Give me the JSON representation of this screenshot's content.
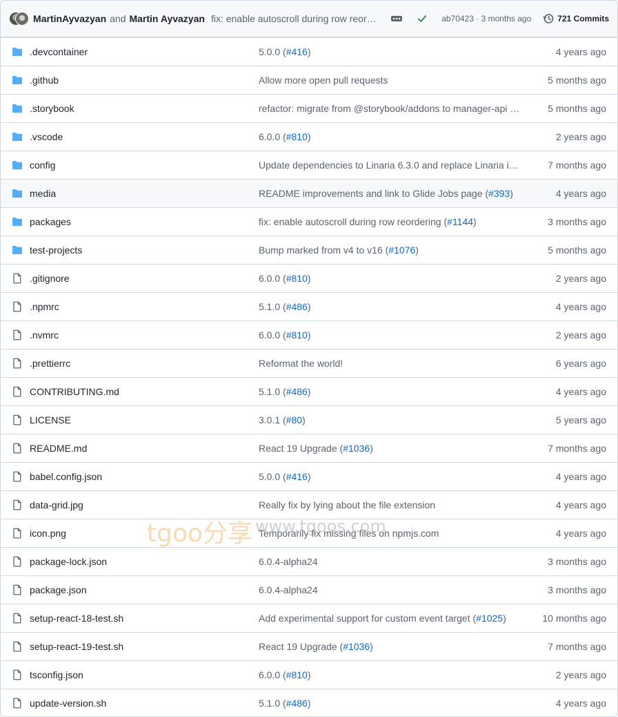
{
  "header": {
    "author1": "MartinAyvazyan",
    "and_text": "and",
    "author2": "Martin Ayvazyan",
    "commit_message": "fix: enable autoscroll during row reorde…",
    "sha_time": "ab70423 · 3 months ago",
    "commits_count": "721 Commits"
  },
  "files": [
    {
      "type": "folder",
      "name": ".devcontainer",
      "msg": "5.0.0 (",
      "link": "#416",
      "msg_end": ")",
      "age": "4 years ago"
    },
    {
      "type": "folder",
      "name": ".github",
      "msg": "Allow more open pull requests",
      "link": "",
      "msg_end": "",
      "age": "5 months ago"
    },
    {
      "type": "folder",
      "name": ".storybook",
      "msg": "refactor: migrate from @storybook/addons to manager-api …",
      "link": "",
      "msg_end": "",
      "age": "5 months ago"
    },
    {
      "type": "folder",
      "name": ".vscode",
      "msg": "6.0.0 (",
      "link": "#810",
      "msg_end": ")",
      "age": "2 years ago"
    },
    {
      "type": "folder",
      "name": "config",
      "msg": "Update dependencies to Linaria 6.3.0 and replace Linaria im…",
      "link": "",
      "msg_end": "",
      "age": "7 months ago"
    },
    {
      "type": "folder",
      "name": "media",
      "msg": "README improvements and link to Glide Jobs page (",
      "link": "#393",
      "msg_end": ")",
      "age": "4 years ago",
      "highlight": true
    },
    {
      "type": "folder",
      "name": "packages",
      "msg": "fix: enable autoscroll during row reordering (",
      "link": "#1144",
      "msg_end": ")",
      "age": "3 months ago"
    },
    {
      "type": "folder",
      "name": "test-projects",
      "msg": "Bump marked from v4 to v16 (",
      "link": "#1076",
      "msg_end": ")",
      "age": "5 months ago"
    },
    {
      "type": "file",
      "name": ".gitignore",
      "msg": "6.0.0 (",
      "link": "#810",
      "msg_end": ")",
      "age": "2 years ago"
    },
    {
      "type": "file",
      "name": ".npmrc",
      "msg": "5.1.0 (",
      "link": "#486",
      "msg_end": ")",
      "age": "4 years ago"
    },
    {
      "type": "file",
      "name": ".nvmrc",
      "msg": "6.0.0 (",
      "link": "#810",
      "msg_end": ")",
      "age": "2 years ago"
    },
    {
      "type": "file",
      "name": ".prettierrc",
      "msg": "Reformat the world!",
      "link": "",
      "msg_end": "",
      "age": "6 years ago"
    },
    {
      "type": "file",
      "name": "CONTRIBUTING.md",
      "msg": "5.1.0 (",
      "link": "#486",
      "msg_end": ")",
      "age": "4 years ago"
    },
    {
      "type": "file",
      "name": "LICENSE",
      "msg": "3.0.1 (",
      "link": "#80",
      "msg_end": ")",
      "age": "5 years ago"
    },
    {
      "type": "file",
      "name": "README.md",
      "msg": "React 19 Upgrade (",
      "link": "#1036",
      "msg_end": ")",
      "age": "7 months ago"
    },
    {
      "type": "file",
      "name": "babel.config.json",
      "msg": "5.0.0 (",
      "link": "#416",
      "msg_end": ")",
      "age": "4 years ago"
    },
    {
      "type": "file",
      "name": "data-grid.jpg",
      "msg": "Really fix by lying about the file extension",
      "link": "",
      "msg_end": "",
      "age": "4 years ago"
    },
    {
      "type": "file",
      "name": "icon.png",
      "msg": "Temporarily fix missing files on npmjs.com",
      "link": "",
      "msg_end": "",
      "age": "4 years ago"
    },
    {
      "type": "file",
      "name": "package-lock.json",
      "msg": "6.0.4-alpha24",
      "link": "",
      "msg_end": "",
      "age": "3 months ago"
    },
    {
      "type": "file",
      "name": "package.json",
      "msg": "6.0.4-alpha24",
      "link": "",
      "msg_end": "",
      "age": "3 months ago"
    },
    {
      "type": "file",
      "name": "setup-react-18-test.sh",
      "msg": "Add experimental support for custom event target (",
      "link": "#1025",
      "msg_end": ")",
      "age": "10 months ago"
    },
    {
      "type": "file",
      "name": "setup-react-19-test.sh",
      "msg": "React 19 Upgrade (",
      "link": "#1036",
      "msg_end": ")",
      "age": "7 months ago"
    },
    {
      "type": "file",
      "name": "tsconfig.json",
      "msg": "6.0.0 (",
      "link": "#810",
      "msg_end": ")",
      "age": "2 years ago"
    },
    {
      "type": "file",
      "name": "update-version.sh",
      "msg": "5.1.0 (",
      "link": "#486",
      "msg_end": ")",
      "age": "4 years ago"
    }
  ],
  "watermark": {
    "brand": "tgoo分享",
    "url": "www.tgoos.com"
  },
  "colors": {
    "folder": "#54aeff",
    "link": "#0969da",
    "muted": "#59636e",
    "border": "#d0d7de",
    "success": "#1a7f37"
  },
  "icons": {
    "folder": "folder-icon",
    "file": "file-icon",
    "history": "history-icon",
    "check": "check-icon",
    "ellipsis": "ellipsis-icon"
  }
}
